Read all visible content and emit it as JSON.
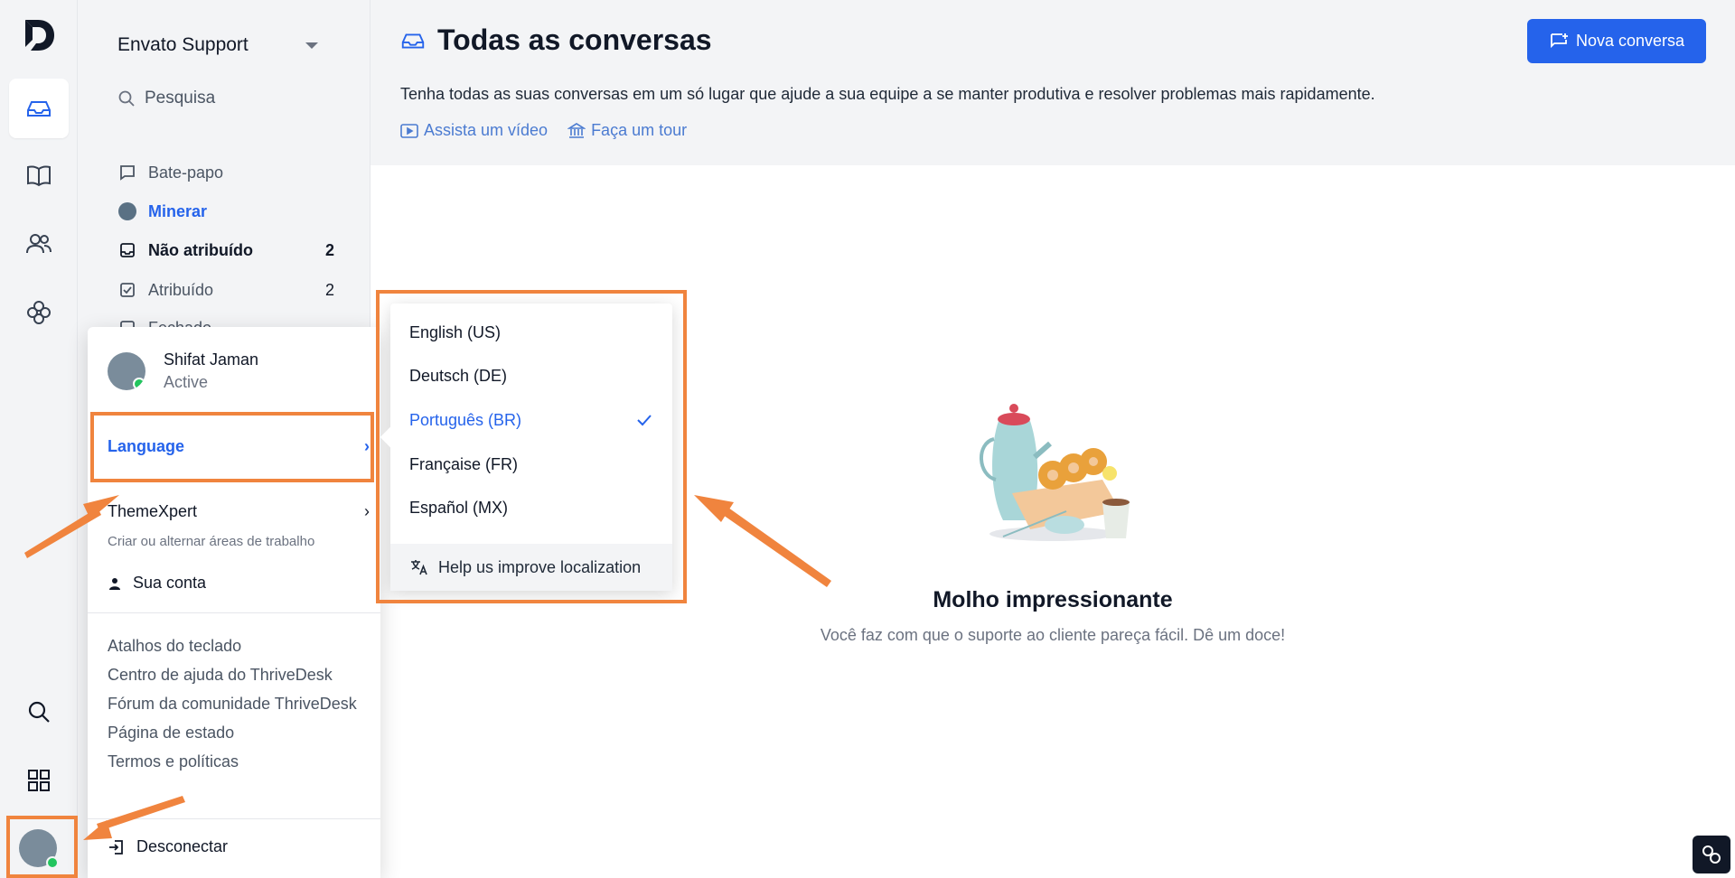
{
  "sidebar": {
    "workspace_name": "Envato Support",
    "search_label": "Pesquisa",
    "nav": [
      {
        "label": "Bate-papo",
        "count": ""
      },
      {
        "label": "Minerar",
        "count": ""
      },
      {
        "label": "Não atribuído",
        "count": "2"
      },
      {
        "label": "Atribuído",
        "count": "2"
      },
      {
        "label": "Fechado",
        "count": ""
      }
    ]
  },
  "header": {
    "title": "Todas as conversas",
    "description": "Tenha todas as suas conversas em um só lugar que ajude a sua equipe a se manter produtiva e resolver problemas mais rapidamente.",
    "watch_video": "Assista um vídeo",
    "take_tour": "Faça um tour",
    "new_conversation": "Nova conversa"
  },
  "empty_state": {
    "title": "Molho impressionante",
    "subtitle": "Você faz com que o suporte ao cliente pareça fácil. Dê um doce!"
  },
  "account_menu": {
    "user_name": "Shifat Jaman",
    "user_status": "Active",
    "language": "Language",
    "workspace": "ThemeXpert",
    "workspace_sub": "Criar ou alternar áreas de trabalho",
    "account": "Sua conta",
    "links": [
      "Atalhos do teclado",
      "Centro de ajuda do ThriveDesk",
      "Fórum da comunidade ThriveDesk",
      "Página de estado",
      "Termos e políticas"
    ],
    "logout": "Desconectar"
  },
  "language_menu": {
    "options": [
      "English (US)",
      "Deutsch (DE)",
      "Português (BR)",
      "Française (FR)",
      "Español (MX)"
    ],
    "selected": "Português (BR)",
    "help": "Help us improve localization"
  },
  "colors": {
    "accent": "#2563eb",
    "highlight": "#f0843e",
    "online": "#22c55e"
  }
}
